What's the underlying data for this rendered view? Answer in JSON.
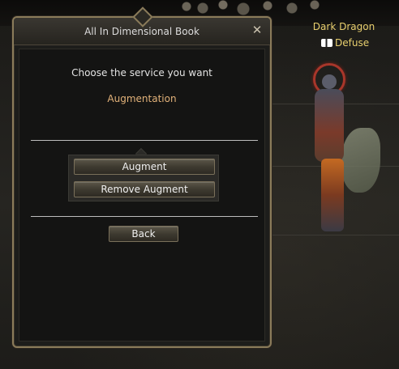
{
  "npc": {
    "title": "Dark Dragon",
    "name": "Defuse",
    "name_color": "#e8cf6e"
  },
  "window": {
    "title": "All In Dimensional Book",
    "close_glyph": "✕",
    "prompt": "Choose the service you want",
    "subtitle": "Augmentation",
    "subtitle_color": "#e2b27a",
    "buttons": {
      "augment": "Augment",
      "remove_augment": "Remove Augment",
      "back": "Back"
    }
  }
}
